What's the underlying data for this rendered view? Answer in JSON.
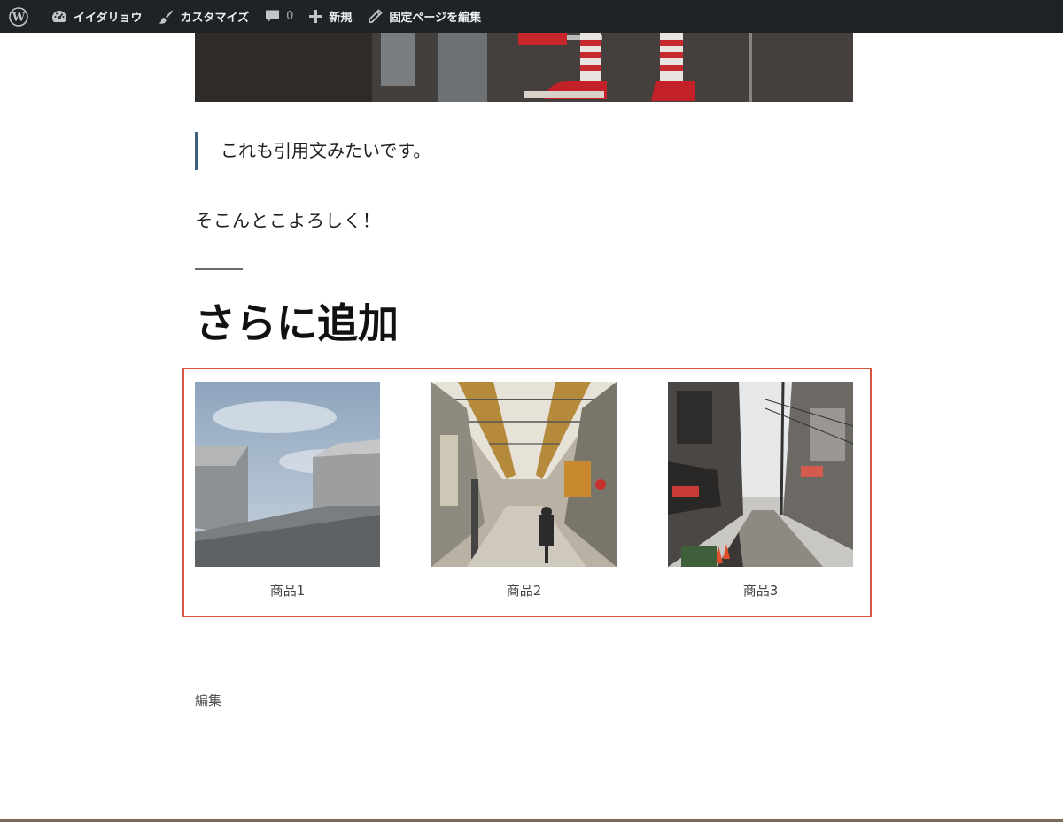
{
  "admin_bar": {
    "site_name": "イイダリョウ",
    "customize": "カスタマイズ",
    "comments_count": "0",
    "new": "新規",
    "edit_page": "固定ページを編集"
  },
  "content": {
    "quote": "これも引用文みたいです。",
    "paragraph": "そこんとこよろしく！",
    "heading": "さらに追加"
  },
  "gallery": {
    "items": [
      {
        "caption": "商品1"
      },
      {
        "caption": "商品2"
      },
      {
        "caption": "商品3"
      }
    ]
  },
  "footer": {
    "edit_label": "編集"
  },
  "colors": {
    "admin_bar_bg": "#1d2327",
    "quote_border": "#3f5f7e",
    "highlight_frame": "#d9553f"
  }
}
